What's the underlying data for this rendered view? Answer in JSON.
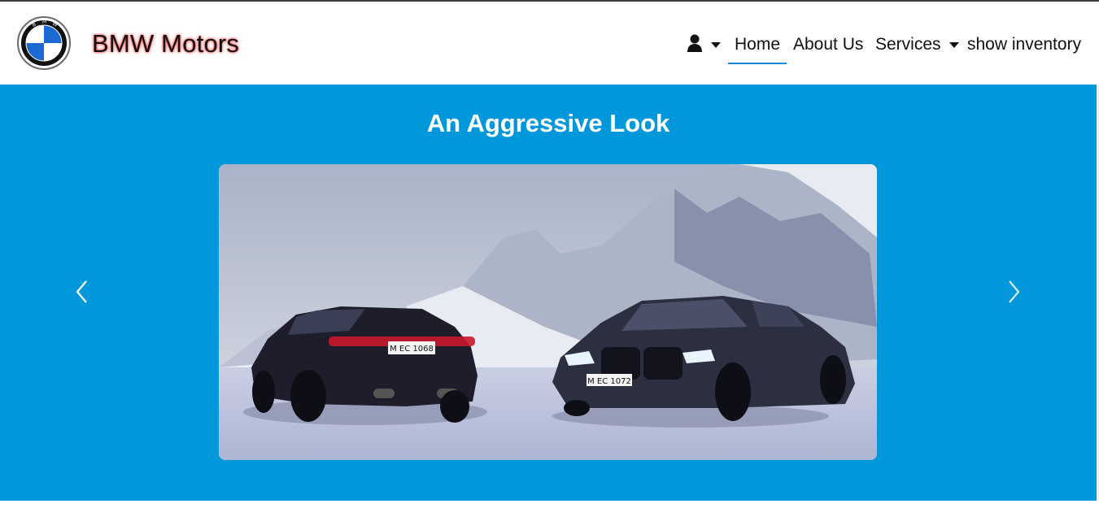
{
  "brand": {
    "logo_icon": "bmw-roundel-icon",
    "logo_text": "BMW",
    "name": "BMW Motors"
  },
  "nav": {
    "user_icon": "user-icon",
    "items": [
      {
        "label": "Home",
        "active": true
      },
      {
        "label": "About Us"
      },
      {
        "label": "Services",
        "dropdown": true
      },
      {
        "label": "show inventory"
      }
    ]
  },
  "hero": {
    "title": "An Aggressive Look",
    "background": "#0098db",
    "slide_image": "two-bmw-cars-in-snowy-mountains",
    "plate_left": "M EC 1068",
    "plate_right": "M EC 1072",
    "prev_icon": "chevron-left-icon",
    "next_icon": "chevron-right-icon"
  },
  "colors": {
    "accent": "#0e8ad6",
    "brand_glow": "#ff3b3b"
  }
}
